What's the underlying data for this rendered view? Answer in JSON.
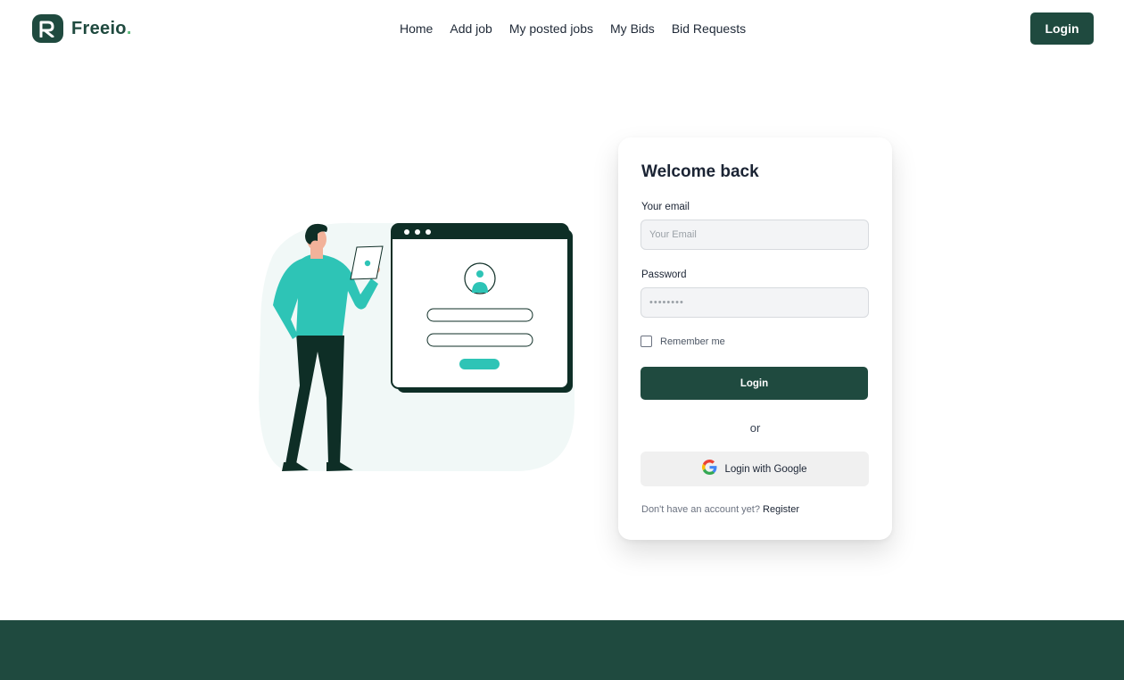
{
  "brand": {
    "name": "Freeio",
    "dot": ".",
    "color": "#1f4a3f",
    "dot_color": "#5bbb7b"
  },
  "nav": {
    "items": [
      {
        "label": "Home"
      },
      {
        "label": "Add job"
      },
      {
        "label": "My posted jobs"
      },
      {
        "label": "My Bids"
      },
      {
        "label": "Bid Requests"
      }
    ],
    "login_label": "Login"
  },
  "login_card": {
    "title": "Welcome back",
    "email_label": "Your email",
    "email_placeholder": "Your Email",
    "password_label": "Password",
    "password_value": "••••••••",
    "remember_label": "Remember me",
    "remember_checked": false,
    "submit_label": "Login",
    "or_text": "or",
    "google_label": "Login with Google",
    "register_prompt": "Don't have an account yet?",
    "register_link": "Register"
  },
  "colors": {
    "primary": "#1f4a3f",
    "accent": "#2ec4b6",
    "input_bg": "#f3f4f6"
  }
}
